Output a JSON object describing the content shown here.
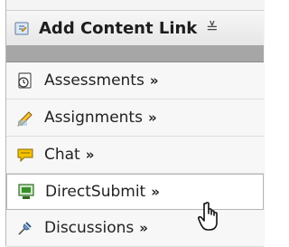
{
  "header": {
    "title": "Add Content Link",
    "menu_glyph": "≚"
  },
  "items": [
    {
      "label": "Assessments",
      "arrow": "»",
      "icon": "assessment-clock-icon"
    },
    {
      "label": "Assignments",
      "arrow": "»",
      "icon": "assignment-pencil-icon"
    },
    {
      "label": "Chat",
      "arrow": "»",
      "icon": "chat-bubble-icon"
    },
    {
      "label": "DirectSubmit",
      "arrow": "»",
      "icon": "direct-submit-monitor-icon"
    },
    {
      "label": "Discussions",
      "arrow": "»",
      "icon": "discussion-pushpin-icon"
    }
  ],
  "colors": {
    "grayBar": "#a6a6a6",
    "chatYellow": "#f3c100",
    "monitorGreen": "#3a8f2a"
  }
}
